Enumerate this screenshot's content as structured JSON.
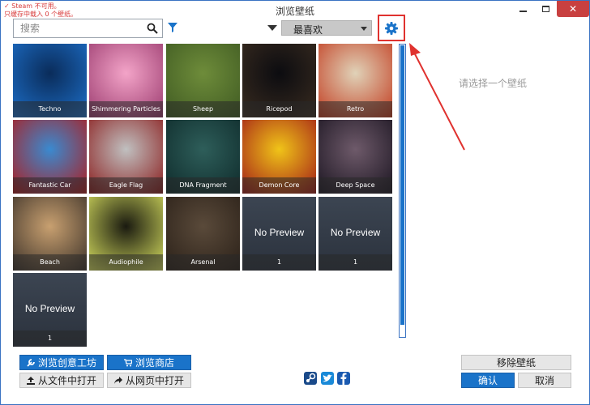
{
  "window": {
    "title": "浏览壁纸",
    "notice_line1": "✓ Steam 不可用。",
    "notice_line2": "只缓存中载入 0 个壁纸。"
  },
  "toolbar": {
    "search_placeholder": "搜索",
    "sort_value": "最喜欢"
  },
  "wallpapers": [
    {
      "title": "Techno",
      "colors": [
        "#0a2c5a",
        "#1d6fc9"
      ]
    },
    {
      "title": "Shimmering Particles",
      "colors": [
        "#f3a4c8",
        "#9a3a6e"
      ]
    },
    {
      "title": "Sheep",
      "colors": [
        "#6e8c3a",
        "#3f5a22"
      ]
    },
    {
      "title": "Ricepod",
      "colors": [
        "#0c0c10",
        "#3a2c20"
      ]
    },
    {
      "title": "Retro",
      "colors": [
        "#e0d2b8",
        "#c23a1e"
      ]
    },
    {
      "title": "Fantastic Car",
      "colors": [
        "#3a8ad0",
        "#b01a1a"
      ]
    },
    {
      "title": "Eagle Flag",
      "colors": [
        "#c0c0c0",
        "#8a1a1a"
      ]
    },
    {
      "title": "DNA Fragment",
      "colors": [
        "#2e5e5a",
        "#0e2a2a"
      ]
    },
    {
      "title": "Demon Core",
      "colors": [
        "#f0c418",
        "#a01818"
      ]
    },
    {
      "title": "Deep Space",
      "colors": [
        "#6e5a6a",
        "#1a1420"
      ]
    },
    {
      "title": "Beach",
      "colors": [
        "#c8a070",
        "#3a3028"
      ]
    },
    {
      "title": "Audiophile",
      "colors": [
        "#1a1a10",
        "#d8e060"
      ]
    },
    {
      "title": "Arsenal",
      "colors": [
        "#5a4a3a",
        "#2a2018"
      ]
    }
  ],
  "no_preview_tiles": [
    {
      "title": "No Preview",
      "label": "1"
    },
    {
      "title": "No Preview",
      "label": "1"
    },
    {
      "title": "No Preview",
      "label": "1"
    }
  ],
  "right_panel": {
    "placeholder": "请选择一个壁纸"
  },
  "bottom": {
    "browse_workshop": "浏览创意工坊",
    "browse_store": "浏览商店",
    "open_from_file": "从文件中打开",
    "open_from_web": "从网页中打开",
    "remove_wallpaper": "移除壁纸",
    "confirm": "确认",
    "cancel": "取消"
  }
}
